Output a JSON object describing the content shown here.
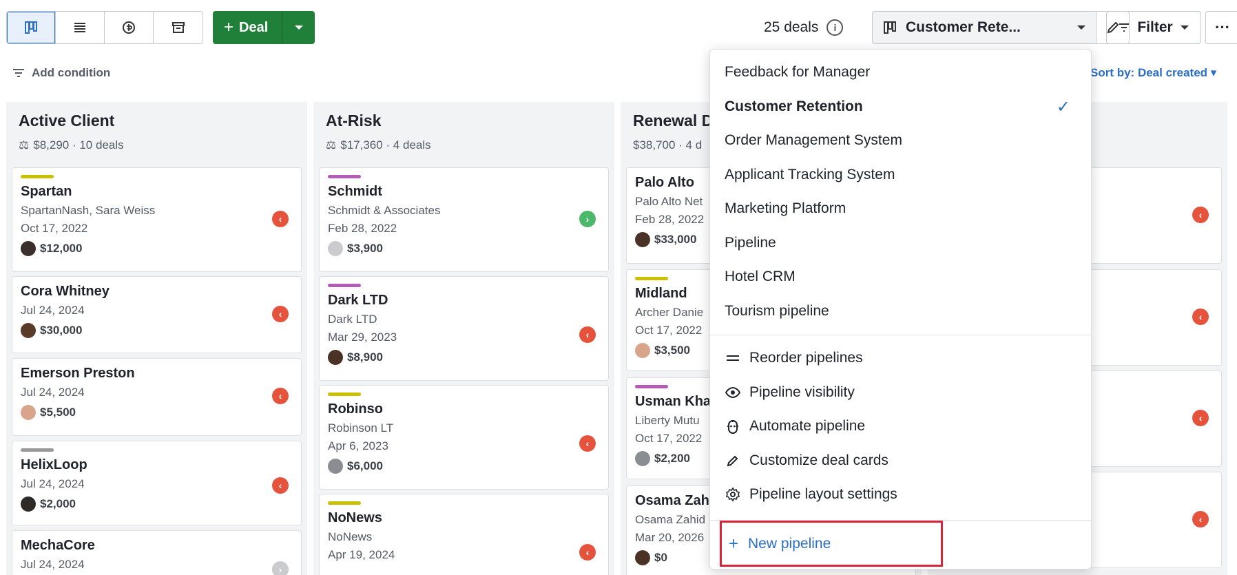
{
  "toolbar": {
    "deal_label": "Deal",
    "deal_count": "25 deals",
    "pipeline_selected": "Customer Rete...",
    "filter_label": "Filter",
    "more_label": "···"
  },
  "conditions": {
    "add_condition": "Add condition",
    "sort_by": "Sort by: Deal created"
  },
  "columns": [
    {
      "title": "Active Client",
      "summary": "$8,290 · 10 deals",
      "cards": [
        {
          "bar": "#c8c000",
          "name": "Spartan",
          "org": "SpartanNash, Sara Weiss",
          "date": "Oct 17, 2022",
          "value": "$12,000",
          "status": "red"
        },
        {
          "bar": "",
          "name": "Cora Whitney",
          "org": "",
          "date": "Jul 24, 2024",
          "value": "$30,000",
          "status": "red"
        },
        {
          "bar": "",
          "name": "Emerson Preston",
          "org": "",
          "date": "Jul 24, 2024",
          "value": "$5,500",
          "status": "red"
        },
        {
          "bar": "#9a9a9a",
          "name": "HelixLoop",
          "org": "",
          "date": "Jul 24, 2024",
          "value": "$2,000",
          "status": "red"
        },
        {
          "bar": "",
          "name": "MechaCore",
          "org": "",
          "date": "Jul 24, 2024",
          "value": "",
          "status": "gray"
        }
      ]
    },
    {
      "title": "At-Risk",
      "summary": "$17,360 · 4 deals",
      "cards": [
        {
          "bar": "#b45bb8",
          "name": "Schmidt",
          "org": "Schmidt & Associates",
          "date": "Feb 28, 2022",
          "value": "$3,900",
          "status": "green"
        },
        {
          "bar": "#b45bb8",
          "name": "Dark LTD",
          "org": "Dark LTD",
          "date": "Mar 29, 2023",
          "value": "$8,900",
          "status": "red"
        },
        {
          "bar": "#c8c000",
          "name": "Robinso",
          "org": "Robinson LT",
          "date": "Apr 6, 2023",
          "value": "$6,000",
          "status": "red"
        },
        {
          "bar": "#c8c000",
          "name": "NoNews",
          "org": "NoNews",
          "date": "Apr 19, 2024",
          "value": "",
          "status": "red"
        }
      ]
    },
    {
      "title": "Renewal D",
      "summary": "$38,700 · 4 d",
      "cards": [
        {
          "bar": "",
          "name": "Palo Alto",
          "org": "Palo Alto Net",
          "date": "Feb 28, 2022",
          "value": "$33,000"
        },
        {
          "bar": "#c8c000",
          "name": "Midland",
          "org": "Archer Danie",
          "date": "Oct 17, 2022",
          "value": "$3,500"
        },
        {
          "bar": "#b45bb8",
          "name": "Usman Kha",
          "org": "Liberty Mutu",
          "date": "Oct 17, 2022",
          "value": "$2,200"
        },
        {
          "bar": "",
          "name": "Osama Zah",
          "org": "Osama Zahid",
          "date": "Mar 20, 2026",
          "value": "$0"
        }
      ]
    }
  ],
  "dropdown": {
    "pipelines": [
      {
        "label": "Feedback for Manager",
        "selected": false
      },
      {
        "label": "Customer Retention",
        "selected": true
      },
      {
        "label": "Order Management System",
        "selected": false
      },
      {
        "label": "Applicant Tracking System",
        "selected": false
      },
      {
        "label": "Marketing Platform",
        "selected": false
      },
      {
        "label": "Pipeline",
        "selected": false
      },
      {
        "label": "Hotel CRM",
        "selected": false
      },
      {
        "label": "Tourism pipeline",
        "selected": false
      }
    ],
    "actions": [
      {
        "label": "Reorder pipelines",
        "icon": "reorder-icon"
      },
      {
        "label": "Pipeline visibility",
        "icon": "eye-icon"
      },
      {
        "label": "Automate pipeline",
        "icon": "robot-icon"
      },
      {
        "label": "Customize deal cards",
        "icon": "pencil-icon"
      },
      {
        "label": "Pipeline layout settings",
        "icon": "gear-icon"
      }
    ],
    "new_pipeline": "New pipeline"
  },
  "colors": {
    "primary_green": "#20803a",
    "link_blue": "#2b6fc9",
    "status_red": "#e5533d",
    "status_green": "#4cb86a",
    "highlight_red": "#d9243a"
  }
}
